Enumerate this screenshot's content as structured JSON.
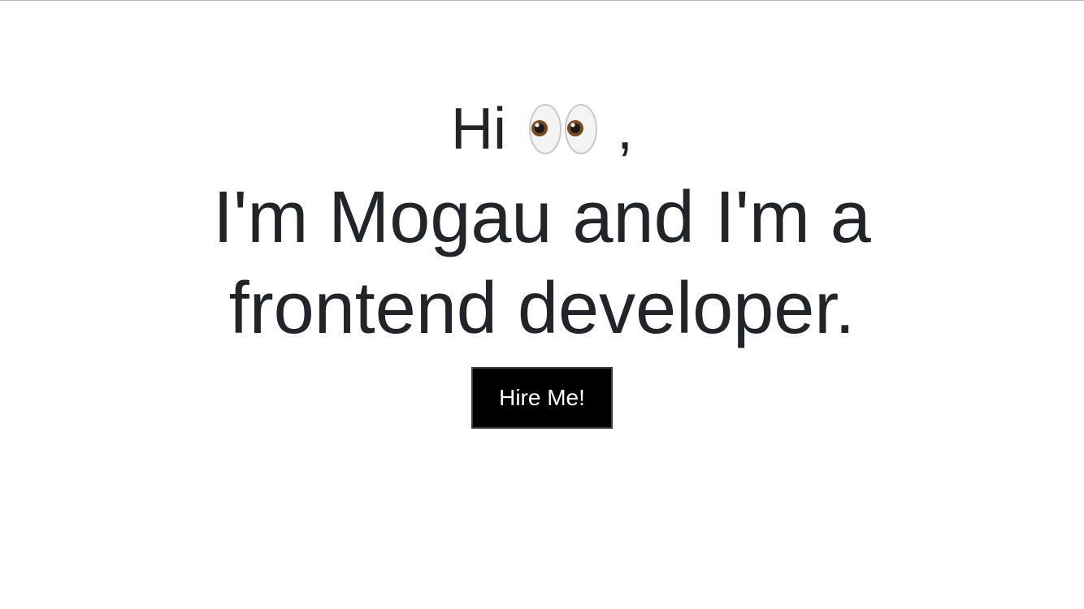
{
  "hero": {
    "greeting_text": "Hi",
    "greeting_icon": "eyes-emoji",
    "greeting_punctuation": ",",
    "headline_line1": "I'm Mogau and I'm a",
    "headline_line2": "frontend developer.",
    "cta_label": "Hire Me!"
  },
  "colors": {
    "text": "#212529",
    "button_bg": "#000000",
    "button_text": "#ffffff",
    "background": "#ffffff"
  }
}
